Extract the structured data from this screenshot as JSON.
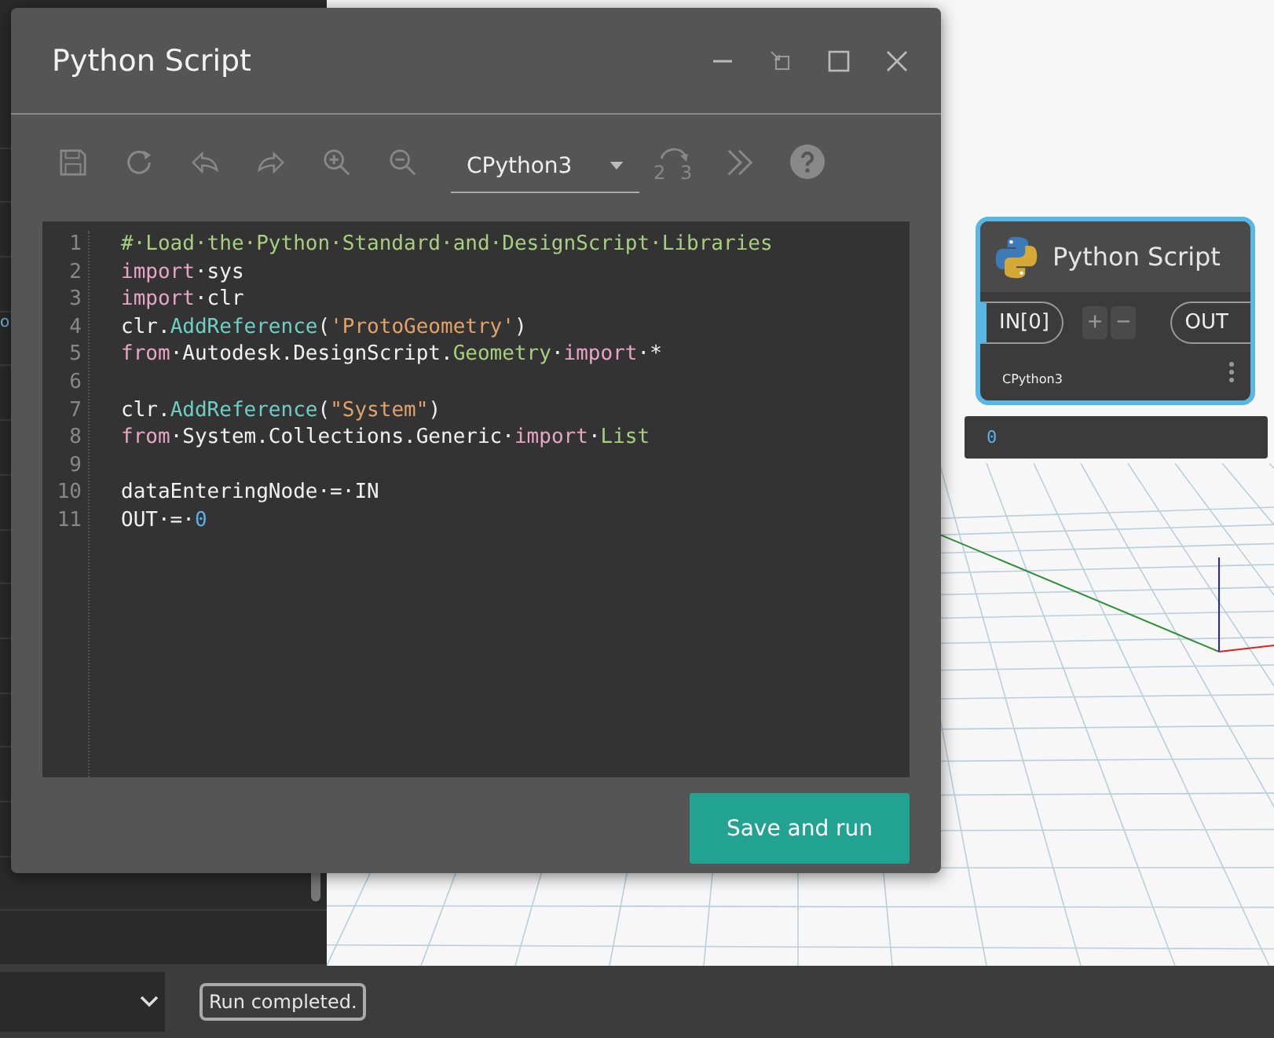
{
  "sidebar": {
    "fragment": "o"
  },
  "canvas": {
    "node": {
      "title": "Python Script",
      "selected": true,
      "inputs": [
        {
          "label": "IN[0]"
        }
      ],
      "add_label": "+",
      "remove_label": "−",
      "output": "OUT",
      "engine": "CPython3"
    },
    "preview": {
      "value": "0"
    }
  },
  "dialog": {
    "title": "Python Script",
    "toolbar": {
      "engine": "CPython3",
      "convert_digits": [
        "2",
        "3"
      ]
    },
    "code": [
      {
        "number": "1",
        "tokens": [
          {
            "kind": "comment",
            "text": "#·Load·the·Python·Standard·and·DesignScript·Libraries"
          }
        ]
      },
      {
        "number": "2",
        "tokens": [
          {
            "kind": "keyword",
            "text": "import"
          },
          {
            "kind": "plain",
            "text": "·sys"
          }
        ]
      },
      {
        "number": "3",
        "tokens": [
          {
            "kind": "keyword",
            "text": "import"
          },
          {
            "kind": "plain",
            "text": "·clr"
          }
        ]
      },
      {
        "number": "4",
        "tokens": [
          {
            "kind": "plain",
            "text": "clr."
          },
          {
            "kind": "func",
            "text": "AddReference"
          },
          {
            "kind": "plain",
            "text": "("
          },
          {
            "kind": "string",
            "text": "'ProtoGeometry'"
          },
          {
            "kind": "plain",
            "text": ")"
          }
        ]
      },
      {
        "number": "5",
        "tokens": [
          {
            "kind": "keyword",
            "text": "from"
          },
          {
            "kind": "plain",
            "text": "·Autodesk.DesignScript."
          },
          {
            "kind": "class",
            "text": "Geometry"
          },
          {
            "kind": "plain",
            "text": "·"
          },
          {
            "kind": "keyword",
            "text": "import"
          },
          {
            "kind": "plain",
            "text": "·*"
          }
        ]
      },
      {
        "number": "6"
      },
      {
        "number": "7",
        "tokens": [
          {
            "kind": "plain",
            "text": "clr."
          },
          {
            "kind": "func",
            "text": "AddReference"
          },
          {
            "kind": "plain",
            "text": "("
          },
          {
            "kind": "string",
            "text": "\"System\""
          },
          {
            "kind": "plain",
            "text": ")"
          }
        ]
      },
      {
        "number": "8",
        "tokens": [
          {
            "kind": "keyword",
            "text": "from"
          },
          {
            "kind": "plain",
            "text": "·System.Collections.Generic·"
          },
          {
            "kind": "keyword",
            "text": "import"
          },
          {
            "kind": "plain",
            "text": "·"
          },
          {
            "kind": "class",
            "text": "List"
          }
        ]
      },
      {
        "number": "9"
      },
      {
        "number": "10",
        "tokens": [
          {
            "kind": "plain",
            "text": "dataEnteringNode·=·IN"
          }
        ]
      },
      {
        "number": "11",
        "tokens": [
          {
            "kind": "plain",
            "text": "OUT·=·"
          },
          {
            "kind": "number",
            "text": "0"
          }
        ]
      }
    ],
    "primary_button": "Save and run"
  },
  "status_bar": {
    "message": "Run completed."
  }
}
